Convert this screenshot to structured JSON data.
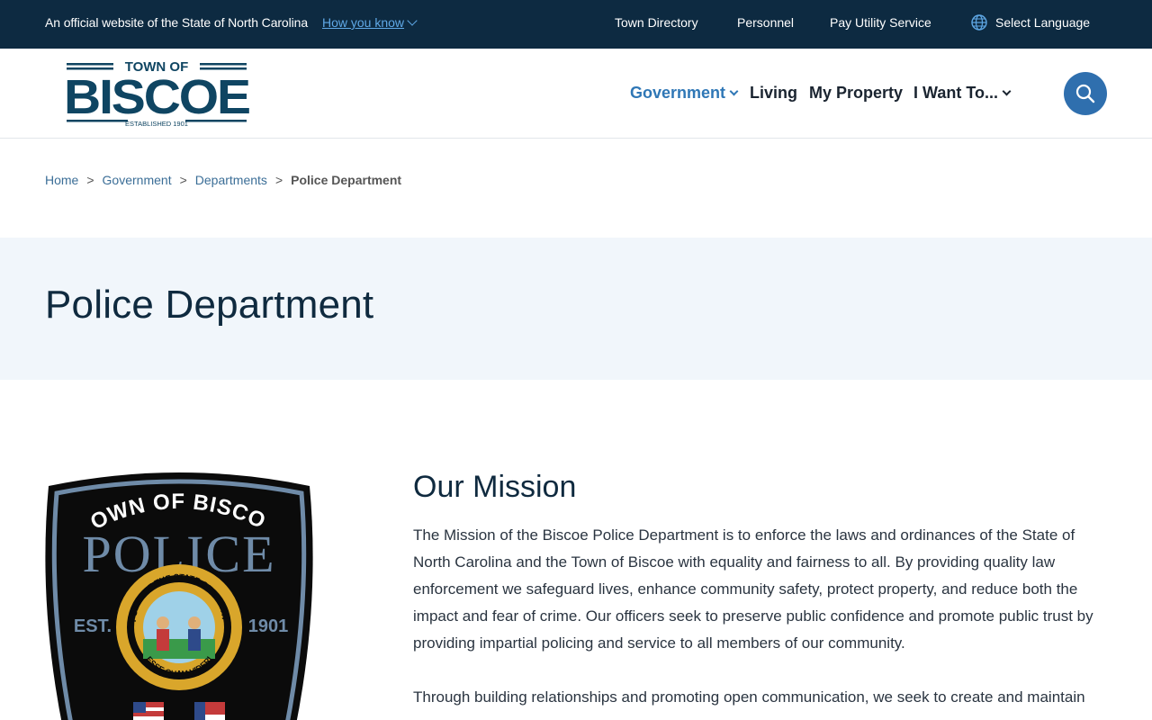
{
  "banner": {
    "official_text": "An official website of the State of North Carolina",
    "how_you_know": "How you know",
    "links": [
      "Town Directory",
      "Personnel",
      "Pay Utility Service"
    ],
    "language": "Select Language"
  },
  "logo": {
    "top": "TOWN OF",
    "main": "BISCOE",
    "sub": "ESTABLISHED 1901"
  },
  "nav": {
    "items": [
      "Government",
      "Living",
      "My Property",
      "I Want To..."
    ],
    "active": "Government"
  },
  "breadcrumb": {
    "items": [
      "Home",
      "Government",
      "Departments"
    ],
    "current": "Police Department",
    "separator": ">"
  },
  "page": {
    "title": "Police Department"
  },
  "badge": {
    "top": "TOWN OF BISCOE",
    "main": "POLICE",
    "est": "EST.",
    "year": "1901",
    "seal_top": "THE GREAT SEAL OF THE STATE OF NORTH CAROLINA",
    "seal_bottom": "ESSE QUAM VIDERI"
  },
  "mission": {
    "heading": "Our Mission",
    "p1": "The Mission of the Biscoe Police Department is to enforce the laws and ordinances of the State of North Carolina and the Town of Biscoe with equality and fairness to all. By providing quality law enforcement we safeguard lives, enhance community safety, protect property, and reduce both the impact and fear of crime. Our officers seek to preserve public confidence and promote public trust by providing impartial policing and service to all members of our community.",
    "p2": "Through building relationships and promoting open communication, we seek to create and maintain"
  },
  "colors": {
    "banner_bg": "#0d2a41",
    "brand_navy": "#0f3f5c",
    "accent_blue": "#2f77b6",
    "title_band": "#f1f6fb"
  }
}
